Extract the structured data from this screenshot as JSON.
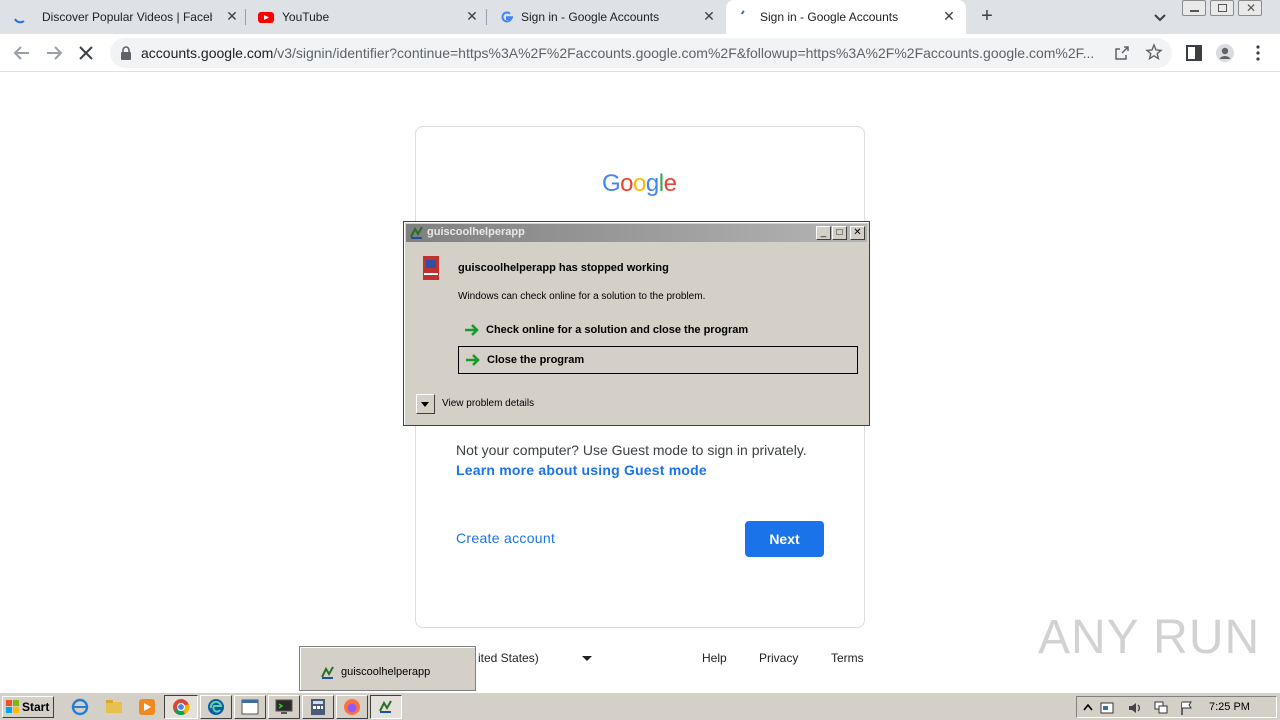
{
  "browser": {
    "tabs": [
      {
        "title": "Discover Popular Videos | Facebook",
        "favicon": "loading-spinner-icon",
        "active": false
      },
      {
        "title": "YouTube",
        "favicon": "youtube-icon",
        "active": false
      },
      {
        "title": "Sign in - Google Accounts",
        "favicon": "google-g-icon",
        "active": false
      },
      {
        "title": "Sign in - Google Accounts",
        "favicon": "loading-spinner-icon",
        "active": true
      }
    ],
    "new_tab": "+",
    "close_glyph": "✕",
    "url_host": "accounts.google.com",
    "url_path": "/v3/signin/identifier?continue=https%3A%2F%2Faccounts.google.com%2F&followup=https%3A%2F%2Faccounts.google.com%2F..."
  },
  "signin": {
    "logo_letters": [
      "G",
      "o",
      "o",
      "g",
      "l",
      "e"
    ],
    "guest_text": "Not your computer? Use Guest mode to sign in privately.",
    "guest_link": "Learn more about using Guest mode",
    "create_account": "Create account",
    "next": "Next"
  },
  "footer": {
    "language": "ited States)",
    "help": "Help",
    "privacy": "Privacy",
    "terms": "Terms"
  },
  "dialog": {
    "title": "guiscoolhelperapp",
    "heading": "guiscoolhelperapp has stopped working",
    "subtext": "Windows can check online for a solution to the problem.",
    "option_check": "Check online for a solution and close the program",
    "option_close": "Close the program",
    "details": "View problem details",
    "btn_min": "_",
    "btn_max": "□",
    "btn_close": "✕"
  },
  "taskbar": {
    "start": "Start",
    "popup_label": "guiscoolhelperapp",
    "clock": "7:25 PM"
  },
  "watermark": "ANY RUN",
  "colors": {
    "accent": "#1a73e8",
    "dialog_bg": "#d4d0c8",
    "tab_strip": "#dee1e6"
  }
}
